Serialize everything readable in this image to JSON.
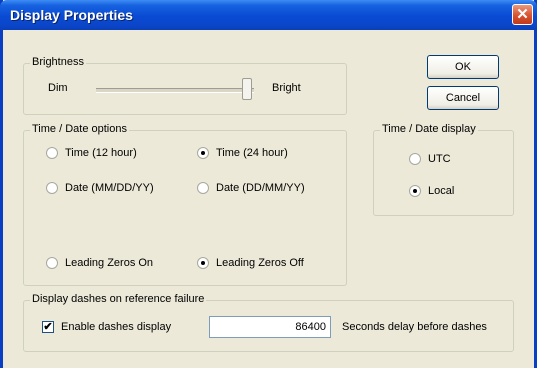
{
  "window": {
    "title": "Display Properties",
    "close_glyph": "✕"
  },
  "buttons": {
    "ok": "OK",
    "cancel": "Cancel"
  },
  "brightness": {
    "legend": "Brightness",
    "dim_label": "Dim",
    "bright_label": "Bright",
    "level": 1.0
  },
  "time_date_options": {
    "legend": "Time / Date options",
    "time12": "Time (12 hour)",
    "time24": "Time (24 hour)",
    "date_mdy": "Date (MM/DD/YY)",
    "date_dmy": "Date (DD/MM/YY)",
    "lead_on": "Leading Zeros On",
    "lead_off": "Leading Zeros Off",
    "selected": [
      "Time (24 hour)",
      "Leading Zeros Off"
    ]
  },
  "time_date_display": {
    "legend": "Time / Date display",
    "utc": "UTC",
    "local": "Local",
    "selected": "Local"
  },
  "dashes": {
    "legend": "Display dashes on reference failure",
    "checkbox_label": "Enable dashes display",
    "checked": true,
    "delay_value": "86400",
    "delay_suffix": "Seconds delay before dashes"
  }
}
